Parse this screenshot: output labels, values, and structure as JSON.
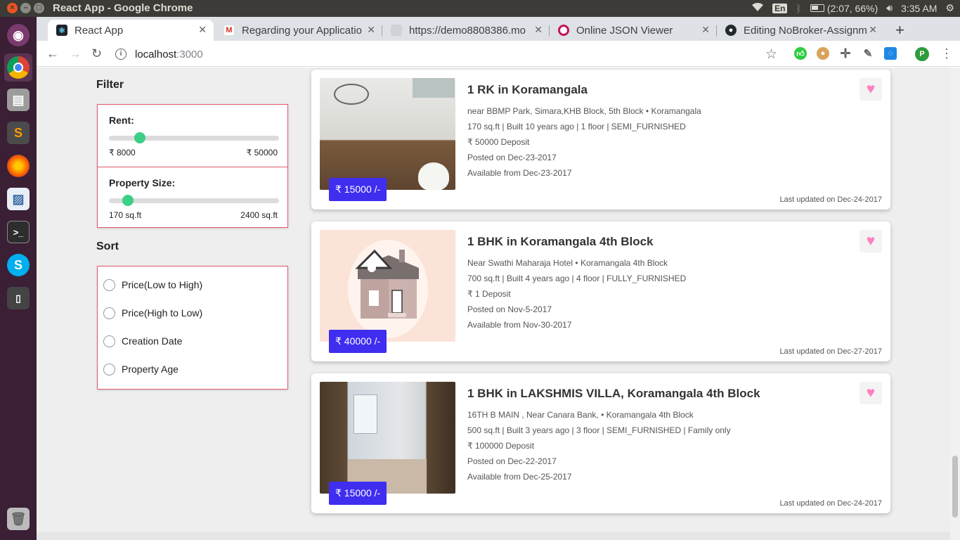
{
  "os": {
    "window_title": "React App - Google Chrome",
    "lang": "En",
    "battery": "(2:07, 66%)",
    "time": "3:35 AM"
  },
  "browser": {
    "tabs": [
      {
        "label": "React App",
        "fav_color": "#0b7285",
        "fav_glyph": "⚛"
      },
      {
        "label": "Regarding your Applicatio",
        "fav_color": "#ffffff",
        "fav_glyph": "M"
      },
      {
        "label": "https://demo8808386.mo",
        "fav_color": "#9aa0a6",
        "fav_glyph": ""
      },
      {
        "label": "Online JSON Viewer",
        "fav_color": "#c2185b",
        "fav_glyph": "O"
      },
      {
        "label": "Editing NoBroker-Assignm",
        "fav_color": "#24292e",
        "fav_glyph": "●"
      }
    ],
    "url_host": "localhost",
    "url_port": ":3000",
    "profile_initial": "P"
  },
  "filter": {
    "title": "Filter",
    "rent": {
      "label": "Rent:",
      "min": "₹ 8000",
      "max": "₹ 50000",
      "knob_fraction": 0.18
    },
    "size": {
      "label": "Property Size:",
      "min": "170 sq.ft",
      "max": "2400 sq.ft",
      "knob_fraction": 0.11
    }
  },
  "sort": {
    "title": "Sort",
    "options": [
      "Price(Low to High)",
      "Price(High to Low)",
      "Creation Date",
      "Property Age"
    ]
  },
  "listings": [
    {
      "title": "1 RK in Koramangala",
      "address": "near BBMP Park, Simara,KHB Block, 5th Block",
      "locality": "Koramangala",
      "details": "170 sq.ft | Built 10 years ago | 1 floor | SEMI_FURNISHED",
      "deposit": "₹ 50000 Deposit",
      "posted": "Posted on Dec-23-2017",
      "available": "Available from Dec-23-2017",
      "price": "₹ 15000 /-",
      "updated": "Last updated on Dec-24-2017"
    },
    {
      "title": "1 BHK in Koramangala 4th Block",
      "address": "Near Swathi Maharaja Hotel",
      "locality": "Koramangala 4th Block",
      "details": "700 sq.ft | Built 4 years ago | 4 floor | FULLY_FURNISHED",
      "deposit": "₹ 1 Deposit",
      "posted": "Posted on Nov-5-2017",
      "available": "Available from Nov-30-2017",
      "price": "₹ 40000 /-",
      "updated": "Last updated on Dec-27-2017"
    },
    {
      "title": "1 BHK in LAKSHMIS VILLA, Koramangala 4th Block",
      "address": "16TH B MAIN , Near Canara Bank,",
      "locality": "Koramangala 4th Block",
      "details": "500 sq.ft | Built 3 years ago | 3 floor | SEMI_FURNISHED | Family only",
      "deposit": "₹ 100000 Deposit",
      "posted": "Posted on Dec-22-2017",
      "available": "Available from Dec-25-2017",
      "price": "₹ 15000 /-",
      "updated": "Last updated on Dec-24-2017"
    }
  ],
  "colors": {
    "accent": "#3f2df0",
    "slider_knob": "#3ccf86",
    "panel_border": "#e05a6e",
    "heart": "#ff7fbf"
  }
}
